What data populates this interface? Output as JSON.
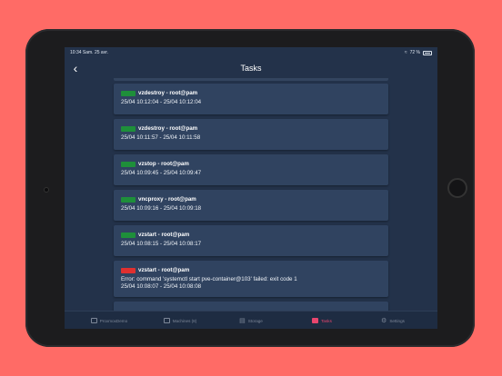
{
  "status_bar": {
    "time": "10:34",
    "date": "Sam. 25 avr.",
    "battery": "72 %"
  },
  "nav": {
    "title": "Tasks",
    "back_icon": "chevron-left-icon"
  },
  "colors": {
    "ok": "#1e8f3a",
    "error": "#e0302f",
    "background": "#ff6b66",
    "active_tab": "#e8466e"
  },
  "tasks": [
    {
      "status": "ok",
      "title": "vzdestroy - root@pam",
      "time": "25/04 10:12:04 - 25/04 10:12:04"
    },
    {
      "status": "ok",
      "title": "vzdestroy - root@pam",
      "time": "25/04 10:11:57 - 25/04 10:11:58"
    },
    {
      "status": "ok",
      "title": "vzstop - root@pam",
      "time": "25/04 10:09:45 - 25/04 10:09:47"
    },
    {
      "status": "ok",
      "title": "vncproxy - root@pam",
      "time": "25/04 10:09:16 - 25/04 10:09:18"
    },
    {
      "status": "ok",
      "title": "vzstart - root@pam",
      "time": "25/04 10:08:15 - 25/04 10:08:17"
    },
    {
      "status": "error",
      "title": "vzstart - root@pam",
      "error": "Error: command 'systemctl start pve-container@103' failed: exit code 1",
      "time": "25/04 10:08:07 - 25/04 10:08:08"
    }
  ],
  "tabs": [
    {
      "label": "ProxmoxDemo",
      "icon": "server-icon"
    },
    {
      "label": "Machines (8)",
      "icon": "monitor-icon"
    },
    {
      "label": "Storage",
      "icon": "storage-icon"
    },
    {
      "label": "Tasks",
      "icon": "tasks-icon",
      "active": true
    },
    {
      "label": "Settings",
      "icon": "gear-icon"
    }
  ]
}
